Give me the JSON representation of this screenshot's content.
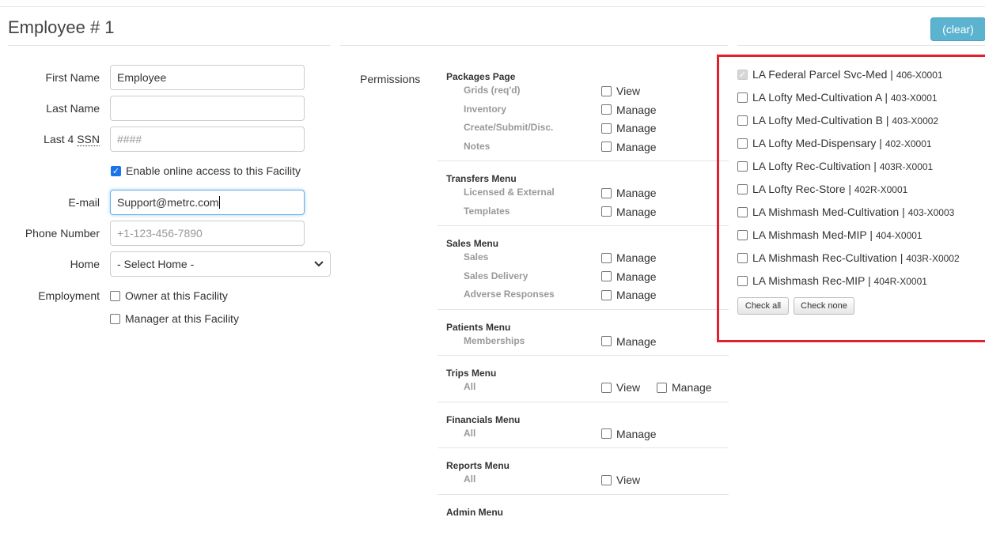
{
  "header": {
    "title": "Employee # 1",
    "clear_label": "(clear)"
  },
  "form": {
    "first_name_label": "First Name",
    "first_name_value": "Employee",
    "last_name_label": "Last Name",
    "last_name_value": "",
    "ssn_label_prefix": "Last 4 ",
    "ssn_label_abbr": "SSN",
    "ssn_placeholder": "####",
    "online_access_label": "Enable online access to this Facility",
    "email_label": "E-mail",
    "email_value": "Support@metrc.com",
    "phone_label": "Phone Number",
    "phone_placeholder": "+1-123-456-7890",
    "home_label": "Home",
    "home_selected": "- Select Home -",
    "employment_label": "Employment",
    "owner_label": "Owner at this Facility",
    "manager_label": "Manager at this Facility"
  },
  "permissions": {
    "label": "Permissions",
    "sections": [
      {
        "title": "Packages Page",
        "rows": [
          {
            "name": "Grids (req'd)",
            "opts": [
              "View"
            ]
          },
          {
            "name": "Inventory",
            "opts": [
              "Manage"
            ]
          },
          {
            "name": "Create/Submit/Disc.",
            "opts": [
              "Manage"
            ]
          },
          {
            "name": "Notes",
            "opts": [
              "Manage"
            ]
          }
        ]
      },
      {
        "title": "Transfers Menu",
        "rows": [
          {
            "name": "Licensed & External",
            "opts": [
              "Manage"
            ]
          },
          {
            "name": "Templates",
            "opts": [
              "Manage"
            ]
          }
        ]
      },
      {
        "title": "Sales Menu",
        "rows": [
          {
            "name": "Sales",
            "opts": [
              "Manage"
            ]
          },
          {
            "name": "Sales Delivery",
            "opts": [
              "Manage"
            ]
          },
          {
            "name": "Adverse Responses",
            "opts": [
              "Manage"
            ]
          }
        ]
      },
      {
        "title": "Patients Menu",
        "rows": [
          {
            "name": "Memberships",
            "opts": [
              "Manage"
            ]
          }
        ]
      },
      {
        "title": "Trips Menu",
        "rows": [
          {
            "name": "All",
            "opts": [
              "View",
              "Manage"
            ]
          }
        ]
      },
      {
        "title": "Financials Menu",
        "rows": [
          {
            "name": "All",
            "opts": [
              "Manage"
            ]
          }
        ]
      },
      {
        "title": "Reports Menu",
        "rows": [
          {
            "name": "All",
            "opts": [
              "View"
            ]
          }
        ]
      },
      {
        "title": "Admin Menu",
        "rows": []
      }
    ]
  },
  "facilities": {
    "items": [
      {
        "name": "LA Federal Parcel Svc-Med | ",
        "license": "406-X0001",
        "disabled": true
      },
      {
        "name": "LA Lofty Med-Cultivation A | ",
        "license": "403-X0001"
      },
      {
        "name": "LA Lofty Med-Cultivation B | ",
        "license": "403-X0002"
      },
      {
        "name": "LA Lofty Med-Dispensary | ",
        "license": "402-X0001"
      },
      {
        "name": "LA Lofty Rec-Cultivation | ",
        "license": "403R-X0001"
      },
      {
        "name": "LA Lofty Rec-Store | ",
        "license": "402R-X0001"
      },
      {
        "name": "LA Mishmash Med-Cultivation | ",
        "license": "403-X0003"
      },
      {
        "name": "LA Mishmash Med-MIP | ",
        "license": "404-X0001"
      },
      {
        "name": "LA Mishmash Rec-Cultivation | ",
        "license": "403R-X0002"
      },
      {
        "name": "LA Mishmash Rec-MIP | ",
        "license": "404R-X0001"
      }
    ],
    "check_all_label": "Check all",
    "check_none_label": "Check none"
  },
  "colors": {
    "highlight": "#e0202a",
    "clear_button": "#5bb3d0",
    "checkbox_checked": "#1a73e8"
  }
}
